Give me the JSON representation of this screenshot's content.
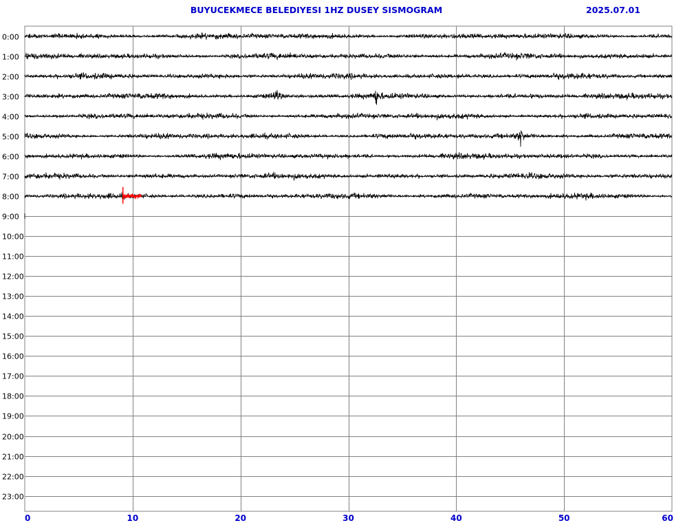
{
  "header": {
    "title": "BUYUCEKMECE BELEDIYESI 1HZ DUSEY SISMOGRAM",
    "date": "2025.07.01"
  },
  "chart_data": {
    "type": "line",
    "title": "BUYUCEKMECE BELEDIYESI 1HZ DUSEY SISMOGRAM",
    "xlabel": "",
    "ylabel": "",
    "xlim": [
      0,
      60
    ],
    "x_ticks": [
      "0",
      "10",
      "20",
      "30",
      "40",
      "50",
      "60"
    ],
    "rows": [
      "0:00",
      "1:00",
      "2:00",
      "3:00",
      "4:00",
      "5:00",
      "6:00",
      "7:00",
      "8:00",
      "9:00",
      "10:00",
      "11:00",
      "12:00",
      "13:00",
      "14:00",
      "15:00",
      "16:00",
      "17:00",
      "18:00",
      "19:00",
      "20:00",
      "21:00",
      "22:00",
      "23:00"
    ],
    "grid": true,
    "recorded_rows": [
      "0:00",
      "1:00",
      "2:00",
      "3:00",
      "4:00",
      "5:00",
      "6:00",
      "7:00",
      "8:00"
    ],
    "trace_color": "#000000",
    "current_position_color": "#ff0000",
    "current_position": {
      "row": "8:00",
      "minute_start": 9.1,
      "minute_end": 10.8
    },
    "events": [
      {
        "row": "3:00",
        "minute": 23.3
      },
      {
        "row": "3:00",
        "minute": 32.6
      },
      {
        "row": "5:00",
        "minute": 46.0
      }
    ]
  }
}
